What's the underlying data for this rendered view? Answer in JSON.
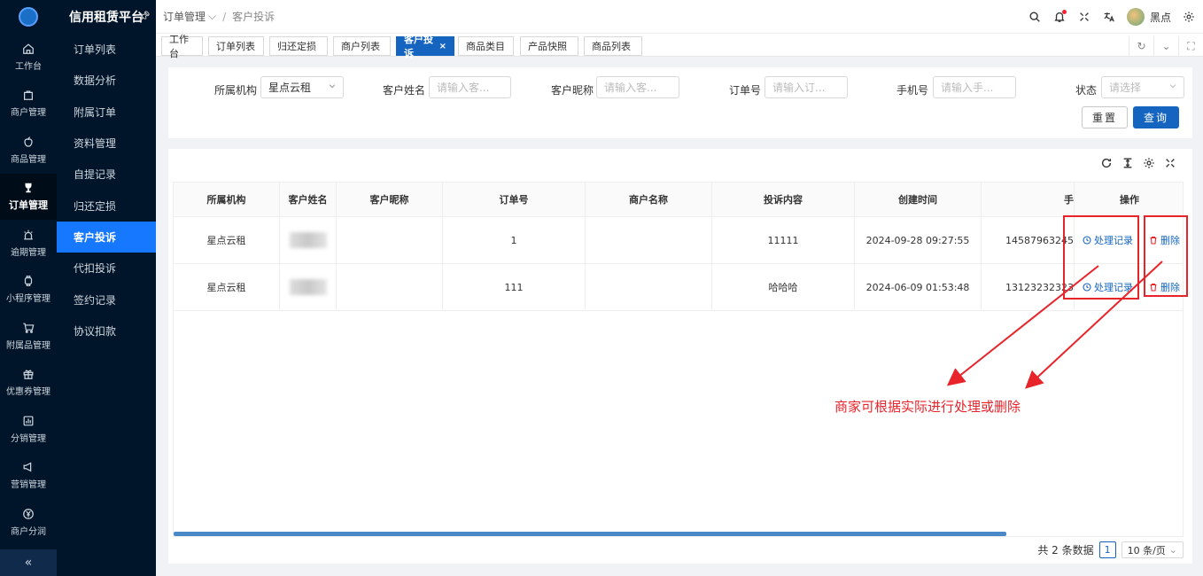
{
  "app": {
    "brand": "信用租赁平台"
  },
  "rail": [
    {
      "label": "工作台",
      "icon": "home-icon"
    },
    {
      "label": "商户管理",
      "icon": "bag-icon"
    },
    {
      "label": "商品管理",
      "icon": "apple-icon"
    },
    {
      "label": "订单管理",
      "icon": "trophy-icon",
      "active": true
    },
    {
      "label": "逾期管理",
      "icon": "alarm-icon"
    },
    {
      "label": "小程序管理",
      "icon": "watch-icon"
    },
    {
      "label": "附属品管理",
      "icon": "cart-icon"
    },
    {
      "label": "优惠券管理",
      "icon": "gift-icon"
    },
    {
      "label": "分销管理",
      "icon": "chart-icon"
    },
    {
      "label": "营销管理",
      "icon": "megaphone-icon"
    },
    {
      "label": "商户分润",
      "icon": "yen-icon"
    }
  ],
  "sub_menu": [
    "订单列表",
    "数据分析",
    "附属订单",
    "资料管理",
    "自提记录",
    "归还定损",
    "客户投诉",
    "代扣投诉",
    "签约记录",
    "协议扣款"
  ],
  "sub_menu_active": "客户投诉",
  "breadcrumb": {
    "parent": "订单管理",
    "current": "客户投诉"
  },
  "user": {
    "name": "黑点"
  },
  "tabs": [
    "工作台",
    "订单列表",
    "归还定损",
    "商户列表",
    "客户投诉",
    "商品类目",
    "产品快照",
    "商品列表"
  ],
  "tab_active": "客户投诉",
  "filters": {
    "org_label": "所属机构",
    "org_value": "星点云租",
    "name_label": "客户姓名",
    "name_ph": "请输入客...",
    "nick_label": "客户昵称",
    "nick_ph": "请输入客...",
    "order_label": "订单号",
    "order_ph": "请输入订...",
    "phone_label": "手机号",
    "phone_ph": "请输入手...",
    "status_label": "状态",
    "status_ph": "请选择",
    "reset": "重置",
    "query": "查询"
  },
  "table": {
    "columns": [
      "所属机构",
      "客户姓名",
      "客户昵称",
      "订单号",
      "商户名称",
      "投诉内容",
      "创建时间",
      "手"
    ],
    "ops_header": "操作",
    "rows": [
      {
        "org": "星点云租",
        "name": "",
        "nick": "",
        "order": "1",
        "merchant": "",
        "content": "11111",
        "time": "2024-09-28 09:27:55",
        "phone": "14587963245"
      },
      {
        "org": "星点云租",
        "name": "",
        "nick": "",
        "order": "111",
        "merchant": "",
        "content": "哈哈哈",
        "time": "2024-06-09 01:53:48",
        "phone": "13123232323"
      }
    ],
    "op_process": "处理记录",
    "op_delete": "删除"
  },
  "pager": {
    "total_text": "共 2 条数据",
    "page": "1",
    "size": "10 条/页"
  },
  "annotation": {
    "text": "商家可根据实际进行处理或删除",
    "color": "#e8242b"
  }
}
